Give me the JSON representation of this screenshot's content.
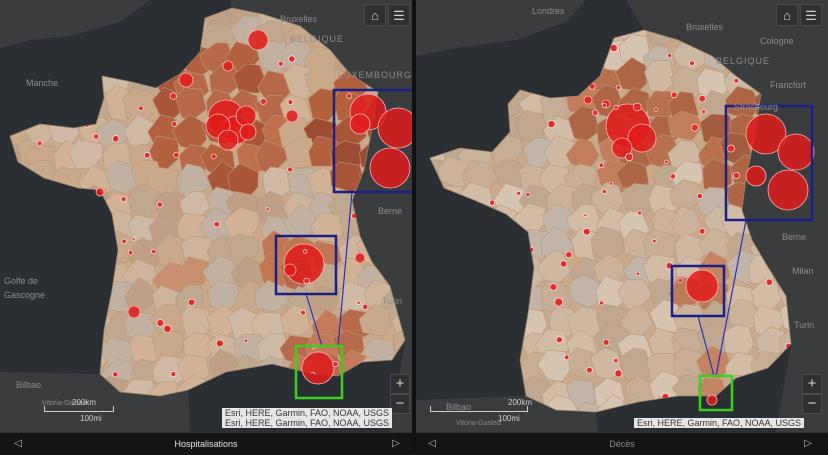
{
  "panels": [
    {
      "id": "left",
      "layer_title": "Hospitalisations",
      "place_labels": [
        {
          "text": "Bruxelles",
          "cls": "bruxelles"
        },
        {
          "text": "BELGIQUE",
          "cls": "belgique"
        },
        {
          "text": "LUXEMBOURG",
          "cls": "lux"
        },
        {
          "text": "Manche",
          "cls": "manche"
        },
        {
          "text": "Berne",
          "cls": "berne"
        },
        {
          "text": "Golfe de Gascogne",
          "cls": "golfe"
        },
        {
          "text": "Turin",
          "cls": "turin"
        },
        {
          "text": "Bilbao",
          "cls": "bilbao"
        },
        {
          "text": "Vitoria-Gasteiz",
          "cls": "vitoria"
        }
      ],
      "attribution": [
        "Esri, HERE, Garmin, FAO, NOAA, USGS",
        "Esri, HERE, Garmin, FAO, NOAA, USGS"
      ],
      "scale": [
        "200km",
        "100mi"
      ]
    },
    {
      "id": "right",
      "layer_title": "Décès",
      "place_labels": [
        {
          "text": "Londres",
          "cls": "londres"
        },
        {
          "text": "Bruxelles",
          "cls": "bruxelles"
        },
        {
          "text": "Cologne",
          "cls": "cologne"
        },
        {
          "text": "BELGIQUE",
          "cls": "belgique"
        },
        {
          "text": "Francfort",
          "cls": "francfort"
        },
        {
          "text": "Strasbourg",
          "cls": "strasbourg"
        },
        {
          "text": "Berne",
          "cls": "berne"
        },
        {
          "text": "Milan",
          "cls": "milan"
        },
        {
          "text": "Turin",
          "cls": "turin"
        },
        {
          "text": "Bilbao",
          "cls": "bilbao"
        },
        {
          "text": "Vitoria-Gasteiz",
          "cls": "vitoria"
        }
      ],
      "attribution": [
        "Esri, HERE, Garmin, FAO, NOAA, USGS"
      ],
      "scale": [
        "200km",
        "100mi"
      ]
    }
  ],
  "zoom": {
    "in": "+",
    "out": "−"
  },
  "icons": {
    "home": "home-icon",
    "layers": "layer-list-icon",
    "prev": "previous-arrow-icon",
    "next": "next-arrow-icon"
  },
  "colors": {
    "highlight_box": "#1b1f8a",
    "focus_box": "#39d11c",
    "bubble": "#e11b1b"
  }
}
